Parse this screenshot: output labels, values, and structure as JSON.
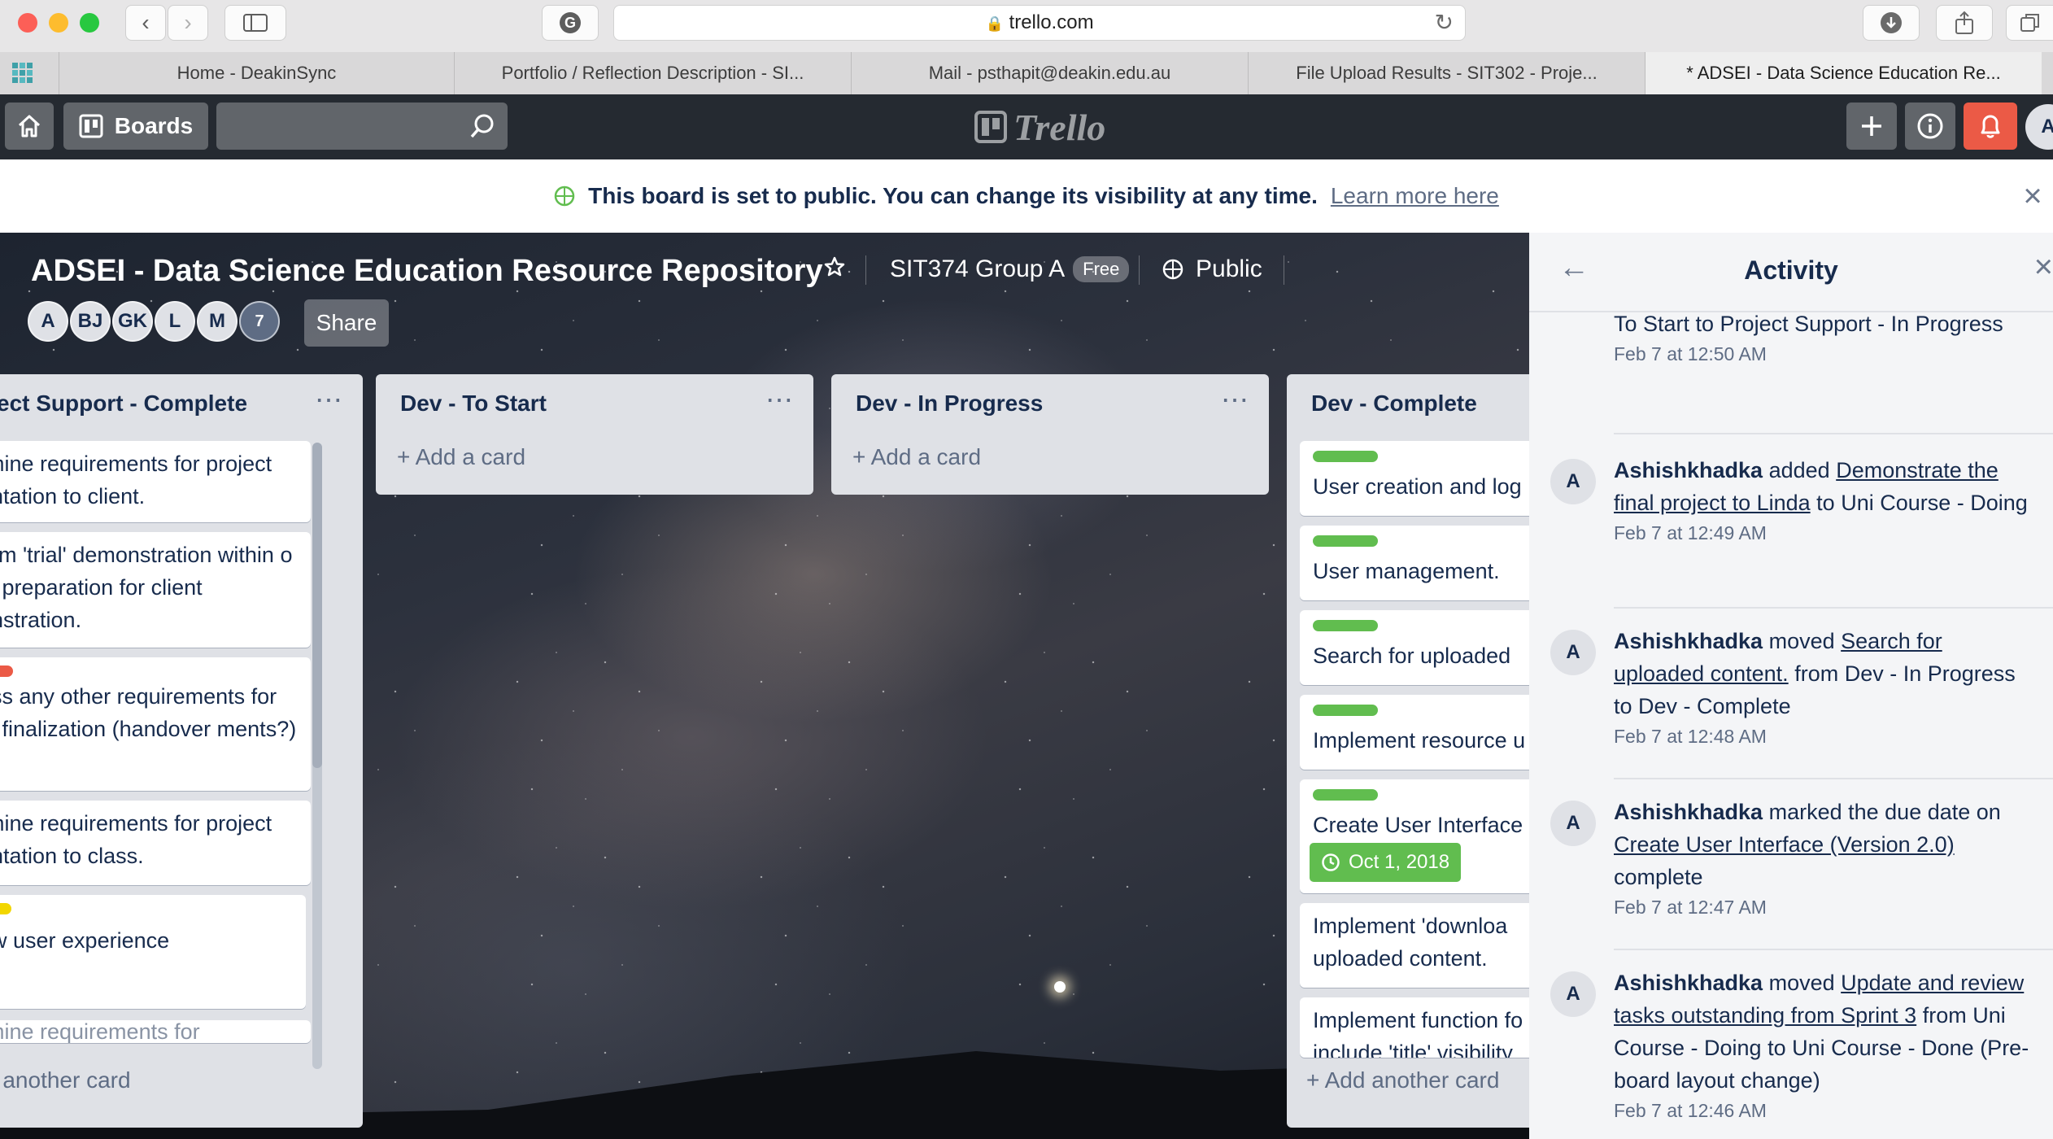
{
  "browser": {
    "url": "trello.com",
    "tabs": [
      "Home - DeakinSync",
      "Portfolio / Reflection Description - SI...",
      "Mail - psthapit@deakin.edu.au",
      "File Upload Results - SIT302 - Proje...",
      "* ADSEI - Data Science Education Re..."
    ]
  },
  "header": {
    "boards_label": "Boards",
    "logo_text": "Trello",
    "avatar_initial": "A"
  },
  "banner": {
    "message": "This board is set to public. You can change its visibility at any time.",
    "link": "Learn more here"
  },
  "board": {
    "title": "ADSEI - Data Science Education Resource Repository",
    "team": "SIT374 Group A",
    "plan": "Free",
    "visibility": "Public",
    "members": [
      "A",
      "BJ",
      "GK",
      "L",
      "M"
    ],
    "more_members": "7",
    "share_label": "Share"
  },
  "lists": [
    {
      "title": "ect Support - Complete",
      "add_label": "d another card",
      "cards": [
        {
          "text": "rmine requirements for project entation to client."
        },
        {
          "text": "orm 'trial' demonstration within o in preparation for client onstration."
        },
        {
          "text": "uss any other requirements for ct finalization (handover ments?)",
          "label_color": "#eb5a46"
        },
        {
          "text": "rmine requirements for project entation to class."
        },
        {
          "text": "ew user experience",
          "label_color": "#f2d600"
        },
        {
          "text": "rmine requirements for"
        }
      ]
    },
    {
      "title": "Dev - To Start",
      "add_label": "Add a card",
      "cards": []
    },
    {
      "title": "Dev - In Progress",
      "add_label": "Add a card",
      "cards": []
    },
    {
      "title": "Dev - Complete",
      "add_label": "Add another card",
      "cards": [
        {
          "text": "User creation and log",
          "label_color": "#61bd4f"
        },
        {
          "text": "User management.",
          "label_color": "#61bd4f"
        },
        {
          "text": "Search for uploaded",
          "label_color": "#61bd4f"
        },
        {
          "text": "Implement resource u",
          "label_color": "#61bd4f"
        },
        {
          "text": "Create User Interface",
          "label_color": "#61bd4f",
          "due": "Oct 1, 2018"
        },
        {
          "text": "Implement 'downloa uploaded content."
        },
        {
          "text": "Implement function fo include 'title' visibility"
        }
      ]
    }
  ],
  "activity": {
    "title": "Activity",
    "entries": [
      {
        "text": "To Start to Project Support - In Progress",
        "time": "Feb 7 at 12:50 AM"
      },
      {
        "user": "Ashishkhadka",
        "action": "added",
        "link": "Demonstrate the final project to Linda",
        "rest": "to Uni Course - Doing",
        "time": "Feb 7 at 12:49 AM"
      },
      {
        "user": "Ashishkhadka",
        "action": "moved",
        "link": "Search for uploaded content.",
        "rest": "from Dev - In Progress to Dev - Complete",
        "time": "Feb 7 at 12:48 AM"
      },
      {
        "user": "Ashishkhadka",
        "action": "marked the due date on",
        "link": "Create User Interface (Version 2.0)",
        "rest": "complete",
        "time": "Feb 7 at 12:47 AM"
      },
      {
        "user": "Ashishkhadka",
        "action": "moved",
        "link": "Update and review tasks outstanding from Sprint 3",
        "rest": "from Uni Course - Doing to Uni Course - Done (Pre- board layout change)",
        "time": "Feb 7 at 12:46 AM"
      }
    ]
  },
  "colors": {
    "header_bg": "#252a31",
    "list_bg": "#dfe1e6",
    "label_green": "#61bd4f",
    "notification_red": "#eb5a46"
  }
}
